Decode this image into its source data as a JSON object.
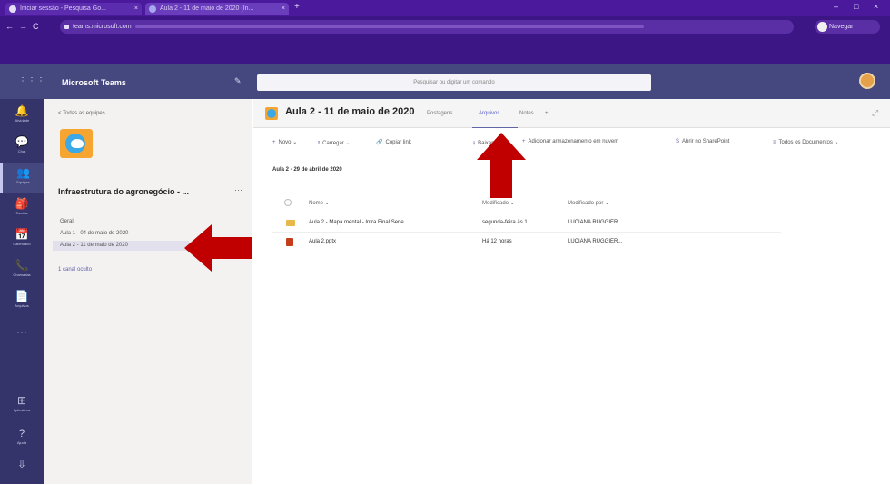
{
  "browser": {
    "tabs": [
      {
        "label": "Iniciar sessão - Pesquisa Go...",
        "icon": "chrome-tab-icon"
      },
      {
        "label": "Aula 2 - 11 de maio de 2020 (In...",
        "icon": "teams-tab-icon"
      }
    ],
    "url_prefix": "teams.microsoft.com",
    "profile_label": "Navegar",
    "window_controls": [
      "–",
      "□",
      "×"
    ]
  },
  "teams": {
    "app_name": "Microsoft Teams",
    "search_placeholder": "Pesquisar ou digitar um comando",
    "rail": [
      {
        "glyph": "🔔",
        "label": "Atividade"
      },
      {
        "glyph": "💬",
        "label": "Chat"
      },
      {
        "glyph": "👥",
        "label": "Equipes",
        "active": true
      },
      {
        "glyph": "🎒",
        "label": "Tarefas"
      },
      {
        "glyph": "📅",
        "label": "Calendário"
      },
      {
        "glyph": "📞",
        "label": "Chamadas"
      },
      {
        "glyph": "📄",
        "label": "Arquivos"
      },
      {
        "glyph": "···",
        "label": ""
      },
      {
        "glyph": "⊞",
        "label": "Aplicativos"
      },
      {
        "glyph": "?",
        "label": "Ajuda"
      },
      {
        "glyph": "⇩",
        "label": ""
      }
    ],
    "all_teams_link": "< Todas as equipes",
    "team_name": "Infraestrutura do agronegócio - ...",
    "team_more": "···",
    "channels": [
      {
        "label": "Geral"
      },
      {
        "label": "Aula 1 - 04 de maio de 2020"
      },
      {
        "label": "Aula 2 - 11 de maio de 2020",
        "selected": true
      }
    ],
    "hidden_channels": "1 canal oculto",
    "channel_title": "Aula 2 - 11 de maio de 2020",
    "header_tabs": [
      {
        "label": "Postagens"
      },
      {
        "label": "Arquivos",
        "active": true
      },
      {
        "label": "Notes"
      },
      {
        "label": "+"
      }
    ],
    "commands": [
      {
        "glyph": "+",
        "label": "Novo ⌄"
      },
      {
        "glyph": "⭱",
        "label": "Carregar ⌄"
      },
      {
        "glyph": "🔗",
        "label": "Copiar link"
      },
      {
        "glyph": "⭳",
        "label": "Baixar"
      },
      {
        "glyph": "+",
        "label": "Adicionar armazenamento em nuvem"
      },
      {
        "glyph": "S",
        "label": "Abrir no SharePoint"
      },
      {
        "glyph": "≡",
        "label": "Todos os Documentos ⌄"
      }
    ],
    "breadcrumb": "Aula 2 - 29 de abril de 2020",
    "file_columns": [
      "Nome ⌄",
      "Modificado ⌄",
      "Modificado por ⌄"
    ],
    "files": [
      {
        "name": "Aula 2 - Mapa mental - Infra Final Serie",
        "modified": "segunda-feira às 1...",
        "modified_by": "LUCIANA RUGGIER...",
        "icon": "folder-icon"
      },
      {
        "name": "Aula 2.pptx",
        "modified": "Há 12 horas",
        "modified_by": "LUCIANA RUGGIER...",
        "icon": "powerpoint-icon"
      }
    ]
  },
  "colors": {
    "browser_purple": "#4b1a9c",
    "teams_header": "#45487f",
    "teams_rail": "#34346a",
    "accent": "#6264a7",
    "arrow_red": "#c00000"
  }
}
